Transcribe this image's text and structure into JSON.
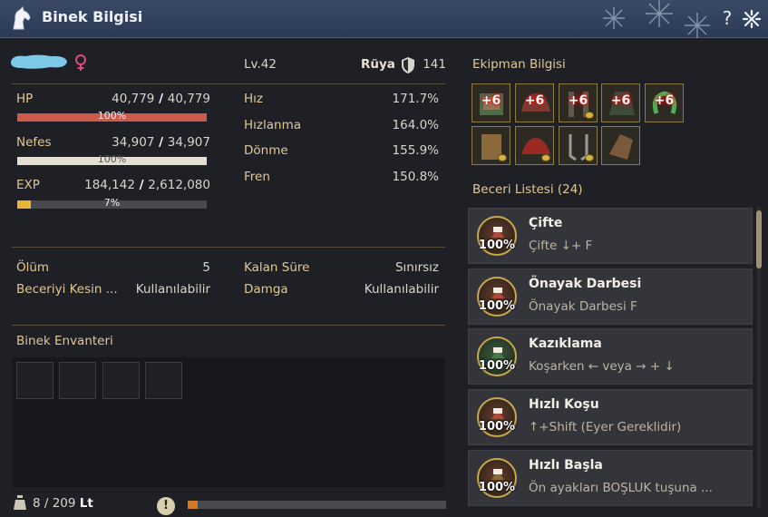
{
  "window": {
    "title": "Binek Bilgisi",
    "help_label": "?"
  },
  "profile": {
    "level": "Lv.42",
    "skill_type": "Rüya",
    "defense": "141"
  },
  "stats": {
    "hp": {
      "label": "HP",
      "current": "40,779",
      "sep": " / ",
      "max": "40,779",
      "pct_label": "100%",
      "fill": 1.0
    },
    "stamina": {
      "label": "Nefes",
      "current": "34,907",
      "sep": " / ",
      "max": "34,907",
      "pct_label": "100%",
      "fill": 1.0
    },
    "exp": {
      "label": "EXP",
      "current": "184,142",
      "sep": " / ",
      "max": "2,612,080",
      "pct_label": "7%",
      "fill": 0.07
    }
  },
  "movement": [
    {
      "label": "Hız",
      "value": "171.7%"
    },
    {
      "label": "Hızlanma",
      "value": "164.0%"
    },
    {
      "label": "Dönme",
      "value": "155.9%"
    },
    {
      "label": "Fren",
      "value": "150.8%"
    }
  ],
  "info": {
    "death_label": "Ölüm",
    "death_value": "5",
    "skill_change_label": "Beceriyi Kesin ...",
    "skill_change_value": "Kullanılabilir",
    "time_label": "Kalan Süre",
    "time_value": "Sınırsız",
    "brand_label": "Damga",
    "brand_value": "Kullanılabilir"
  },
  "inventory": {
    "title": "Binek Envanteri",
    "weight": "8 / 209",
    "weight_unit": "Lt",
    "warn_label": "!",
    "weight_fill": 0.04
  },
  "equipment": {
    "title": "Ekipman Bilgisi",
    "enhanced": [
      "+6",
      "+6",
      "+6",
      "+6",
      "+6"
    ]
  },
  "skills": {
    "title": "Beceri Listesi (24)",
    "items": [
      {
        "name": "Çifte",
        "key": "Çifte ↓+ F",
        "pct": "100%"
      },
      {
        "name": "Önayak Darbesi",
        "key": "Önayak Darbesi F",
        "pct": "100%"
      },
      {
        "name": "Kazıklama",
        "key": "Koşarken ← veya → + ↓",
        "pct": "100%"
      },
      {
        "name": "Hızlı Koşu",
        "key": "↑+Shift (Eyer Gereklidir)",
        "pct": "100%"
      },
      {
        "name": "Hızlı Başla",
        "key": "Ön ayakları BOŞLUK tuşuna ...",
        "pct": "100%"
      }
    ]
  },
  "colors": {
    "accent": "#e2c796",
    "hp": "#cf5a4b",
    "stamina": "#e4dfcf",
    "exp": "#e8b53a",
    "weight": "#cf7a22",
    "title_bar": "#2b3a55"
  }
}
